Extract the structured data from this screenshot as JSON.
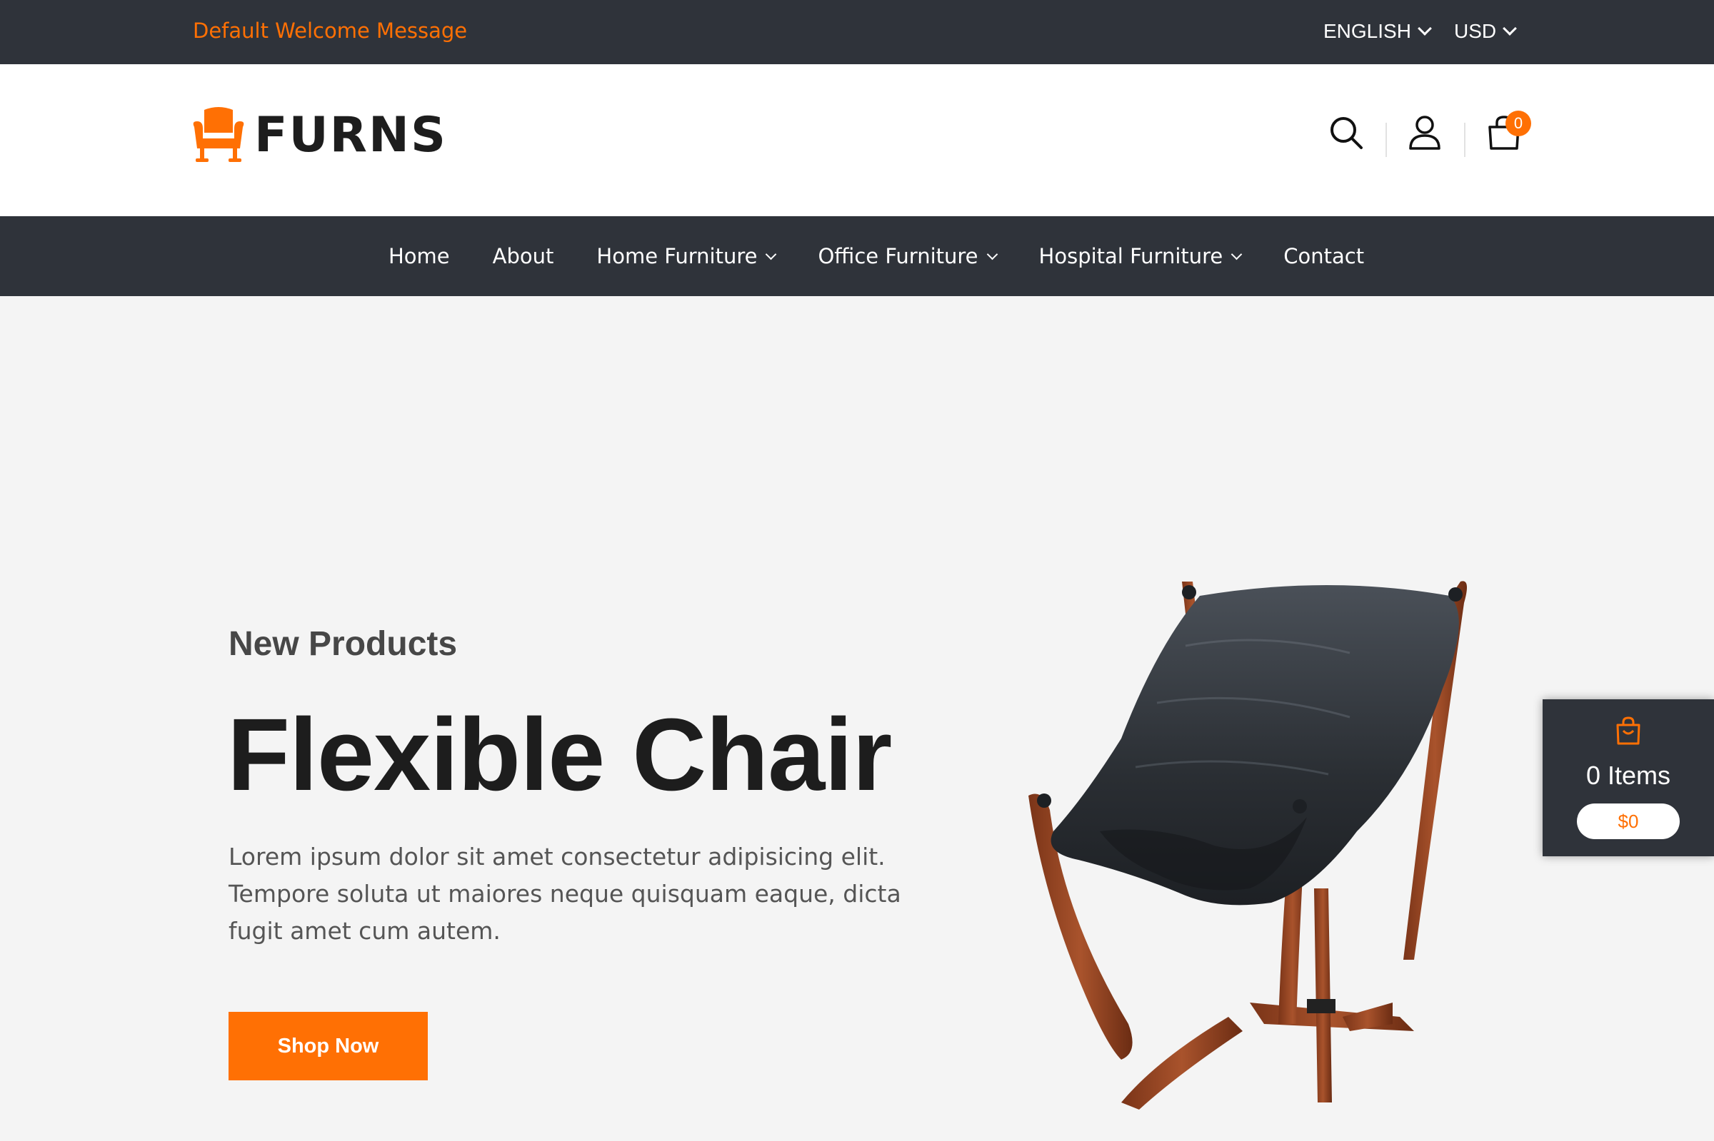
{
  "topbar": {
    "welcome": "Default Welcome Message",
    "language": "ENGLISH",
    "currency": "USD"
  },
  "header": {
    "logo_text": "FURNS",
    "cart_count": "0"
  },
  "nav": {
    "items": [
      {
        "label": "Home",
        "dropdown": false
      },
      {
        "label": "About",
        "dropdown": false
      },
      {
        "label": "Home Furniture",
        "dropdown": true
      },
      {
        "label": "Office Furniture",
        "dropdown": true
      },
      {
        "label": "Hospital Furniture",
        "dropdown": true
      },
      {
        "label": "Contact",
        "dropdown": false
      }
    ]
  },
  "hero": {
    "subtitle": "New Products",
    "title": "Flexible Chair",
    "description": "Lorem ipsum dolor sit amet consectetur adipisicing elit. Tempore soluta ut maiores neque quisquam eaque, dicta fugit amet cum autem.",
    "button": "Shop Now"
  },
  "side_cart": {
    "items": "0 Items",
    "total": "$0"
  },
  "colors": {
    "accent": "#ff7004",
    "dark": "#2f333a",
    "hero_bg": "#f4f4f4"
  },
  "icons": [
    "chair-logo-icon",
    "search-icon",
    "user-icon",
    "cart-icon",
    "chevron-down-icon",
    "bag-icon"
  ]
}
